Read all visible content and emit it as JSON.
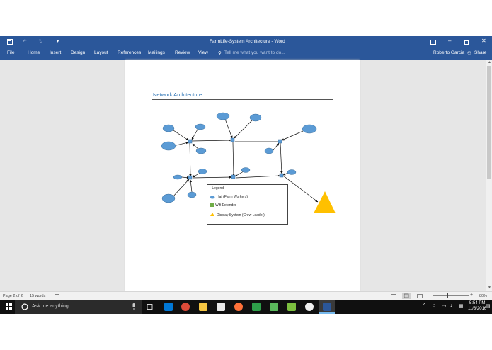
{
  "window": {
    "title": "FarmLife-System Architecture - Word",
    "user": "Roberto Garcia",
    "share_label": "Share"
  },
  "ribbon": {
    "tabs": [
      "File",
      "Home",
      "Insert",
      "Design",
      "Layout",
      "References",
      "Mailings",
      "Review",
      "View"
    ],
    "tell_me": "Tell me what you want to do..."
  },
  "document": {
    "heading": "Network Architecture",
    "legend": {
      "title": "--Legend--",
      "items": [
        {
          "label": "Hat (Farm Workers)",
          "symbol": "blue-ellipse"
        },
        {
          "label": "Wifi Extender",
          "symbol": "green-square"
        },
        {
          "label": "Display System (Crew Leader)",
          "symbol": "yellow-triangle"
        }
      ]
    }
  },
  "status": {
    "page": "Page 2 of 2",
    "words": "15 words",
    "zoom": "80%"
  },
  "taskbar": {
    "search_placeholder": "Ask me anything",
    "time": "5:54 PM",
    "date": "11/3/2016"
  },
  "colors": {
    "word_blue": "#2b579a",
    "node_blue": "#5b9bd5",
    "triangle": "#ffc000",
    "heading": "#2e74b5"
  }
}
